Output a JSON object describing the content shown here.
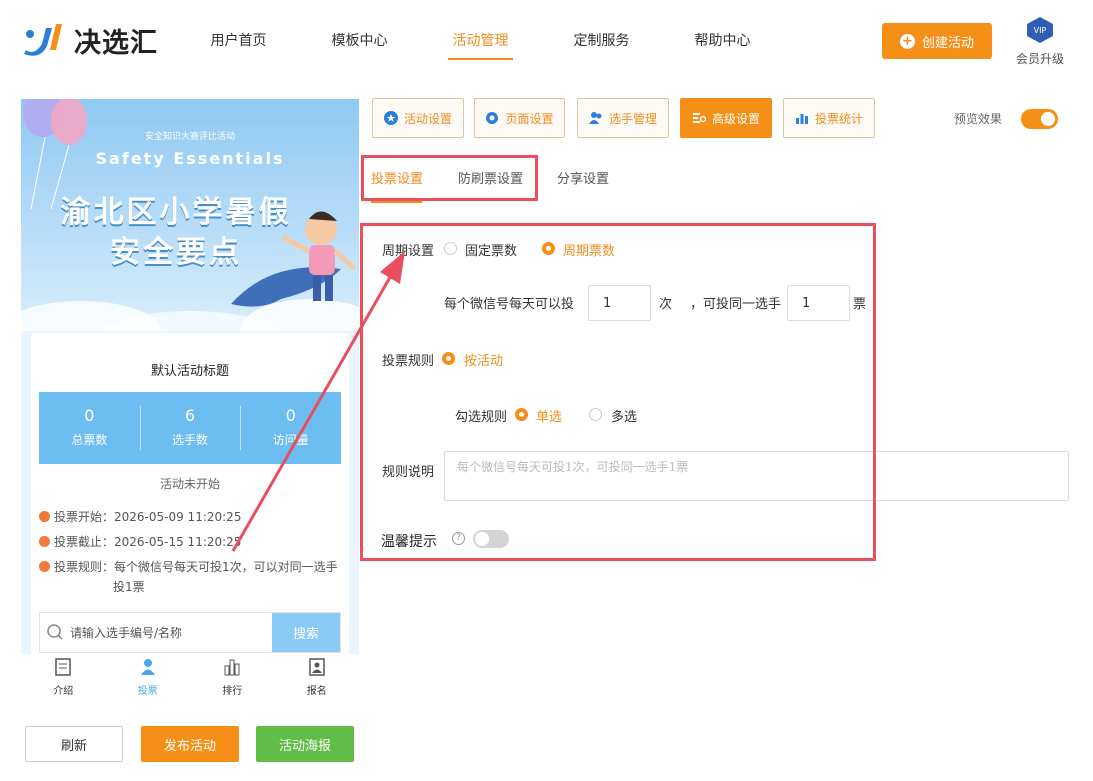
{
  "app": {
    "brand": "决选汇"
  },
  "nav": {
    "items": [
      {
        "label": "用户首页"
      },
      {
        "label": "模板中心"
      },
      {
        "label": "活动管理"
      },
      {
        "label": "定制服务"
      },
      {
        "label": "帮助中心"
      }
    ],
    "active": "活动管理",
    "create_label": "创建活动",
    "vip_badge": "VIP",
    "vip_label": "会员升级"
  },
  "preview": {
    "banner_small": "安全知识大赛评比活动",
    "banner_en": "Safety  Essentials",
    "banner_title_line1": "渝北区小学暑假",
    "banner_title_line2": "安全要点",
    "card_title": "默认活动标题",
    "stats": [
      {
        "value": "0",
        "label": "总票数"
      },
      {
        "value": "6",
        "label": "选手数"
      },
      {
        "value": "0",
        "label": "访问量"
      }
    ],
    "status": "活动未开始",
    "vote_start": "投票开始：2026-05-09 11:20:25",
    "vote_end": "投票截止：2026-05-15 11:20:25",
    "vote_rule_line1": "投票规则：每个微信号每天可投1次，可以对同一选手",
    "vote_rule_line2": "投1票",
    "search_placeholder": "请输入选手编号/名称",
    "search_button": "搜索",
    "tabs": [
      {
        "label": "介绍",
        "icon": "doc-icon"
      },
      {
        "label": "投票",
        "icon": "person-icon"
      },
      {
        "label": "排行",
        "icon": "bar-chart-icon"
      },
      {
        "label": "报名",
        "icon": "signup-icon"
      }
    ],
    "active_tab": "投票"
  },
  "actions": {
    "refresh": "刷新",
    "publish": "发布活动",
    "poster": "活动海报"
  },
  "panel": {
    "tabs": [
      {
        "label": "活动设置",
        "icon": "star-icon"
      },
      {
        "label": "页面设置",
        "icon": "gear-icon"
      },
      {
        "label": "选手管理",
        "icon": "users-icon"
      },
      {
        "label": "高级设置",
        "icon": "advanced-settings-icon"
      },
      {
        "label": "投票统计",
        "icon": "stats-icon"
      }
    ],
    "active_tab": "高级设置",
    "preview_label": "预览效果",
    "preview_on": true,
    "subtabs": [
      {
        "label": "投票设置"
      },
      {
        "label": "防刷票设置"
      },
      {
        "label": "分享设置"
      }
    ],
    "active_subtab": "投票设置"
  },
  "form": {
    "period_label": "周期设置",
    "period_options": [
      "固定票数",
      "周期票数"
    ],
    "period_selected": "周期票数",
    "per_wechat_label": "每个微信号每天可以投",
    "times_value": "1",
    "times_unit": "次",
    "same_player_label": "，可投同一选手",
    "same_player_value": "1",
    "votes_unit": "票",
    "vote_rule_label": "投票规则",
    "vote_rule_option": "按活动",
    "select_rule_label": "勾选规则",
    "select_options": [
      "单选",
      "多选"
    ],
    "select_selected": "单选",
    "rule_desc_label": "规则说明",
    "rule_desc_placeholder": "每个微信号每天可投1次，可投同一选手1票",
    "tip_label": "温馨提示",
    "tip_help": "?",
    "tip_on": false
  },
  "colors": {
    "accent": "#f68f17",
    "highlight": "#e94f5f",
    "preview_blue": "#6bbdf2",
    "poster_green": "#62bd46"
  }
}
